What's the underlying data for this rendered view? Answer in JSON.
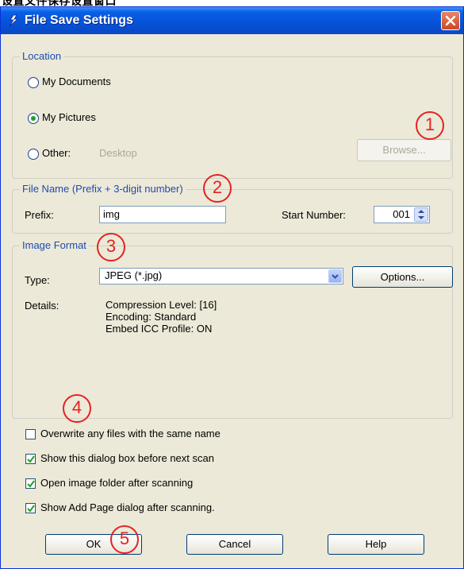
{
  "clipped_header": "设置文件保存设置窗口",
  "window": {
    "title": "File Save Settings"
  },
  "location": {
    "legend": "Location",
    "options": [
      "My Documents",
      "My Pictures",
      "Other:"
    ],
    "selected": "My Pictures",
    "other_value": "Desktop",
    "browse_label": "Browse..."
  },
  "file_name": {
    "legend": "File Name (Prefix + 3-digit number)",
    "prefix_label": "Prefix:",
    "prefix_value": "img",
    "start_label": "Start Number:",
    "start_value": "001"
  },
  "image_format": {
    "legend": "Image Format",
    "type_label": "Type:",
    "type_value": "JPEG (*.jpg)",
    "options_label": "Options...",
    "details_label": "Details:",
    "details": [
      "Compression Level: [16]",
      "Encoding: Standard",
      "Embed ICC Profile: ON"
    ]
  },
  "checkboxes": [
    {
      "label": "Overwrite any files with the same name",
      "checked": false
    },
    {
      "label": "Show this dialog box before next scan",
      "checked": true
    },
    {
      "label": "Open image folder after scanning",
      "checked": true
    },
    {
      "label": "Show Add Page dialog after scanning.",
      "checked": true
    }
  ],
  "buttons": {
    "ok": "OK",
    "cancel": "Cancel",
    "help": "Help"
  },
  "markers": [
    "1",
    "2",
    "3",
    "4",
    "5"
  ],
  "colors": {
    "title_bar": "#0553d9",
    "dialog_bg": "#ece9d8",
    "legend_text": "#1f4bb0",
    "marker": "#e52222",
    "check": "#21a121"
  }
}
